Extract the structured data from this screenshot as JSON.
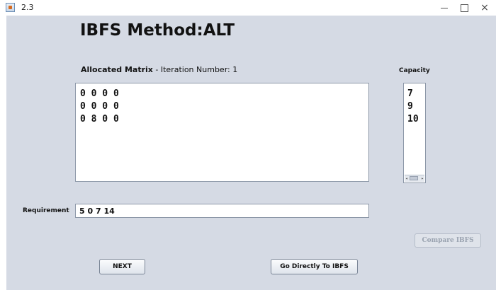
{
  "window": {
    "title": "2.3",
    "controls": [
      "minimize-icon",
      "maximize-icon",
      "close-icon"
    ],
    "close_glyph": "×"
  },
  "heading": "IBFS Method:ALT",
  "allocated": {
    "label_bold": "Allocated Matrix",
    "label_rest": " - Iteration Number: 1",
    "rows": [
      "0 0 0 0",
      "0 0 0 0",
      "0 8 0 0"
    ]
  },
  "capacity": {
    "label": "Capacity",
    "values": [
      "7",
      "9",
      "10"
    ]
  },
  "requirement": {
    "label": "Requirement",
    "value": "5 0 7 14"
  },
  "buttons": {
    "compare": "Compare IBFS",
    "next": "NEXT",
    "go_ibfs": "Go Directly To IBFS"
  },
  "colors": {
    "panel_bg": "#d5dae4",
    "disabled_text": "#9aa3b0"
  }
}
